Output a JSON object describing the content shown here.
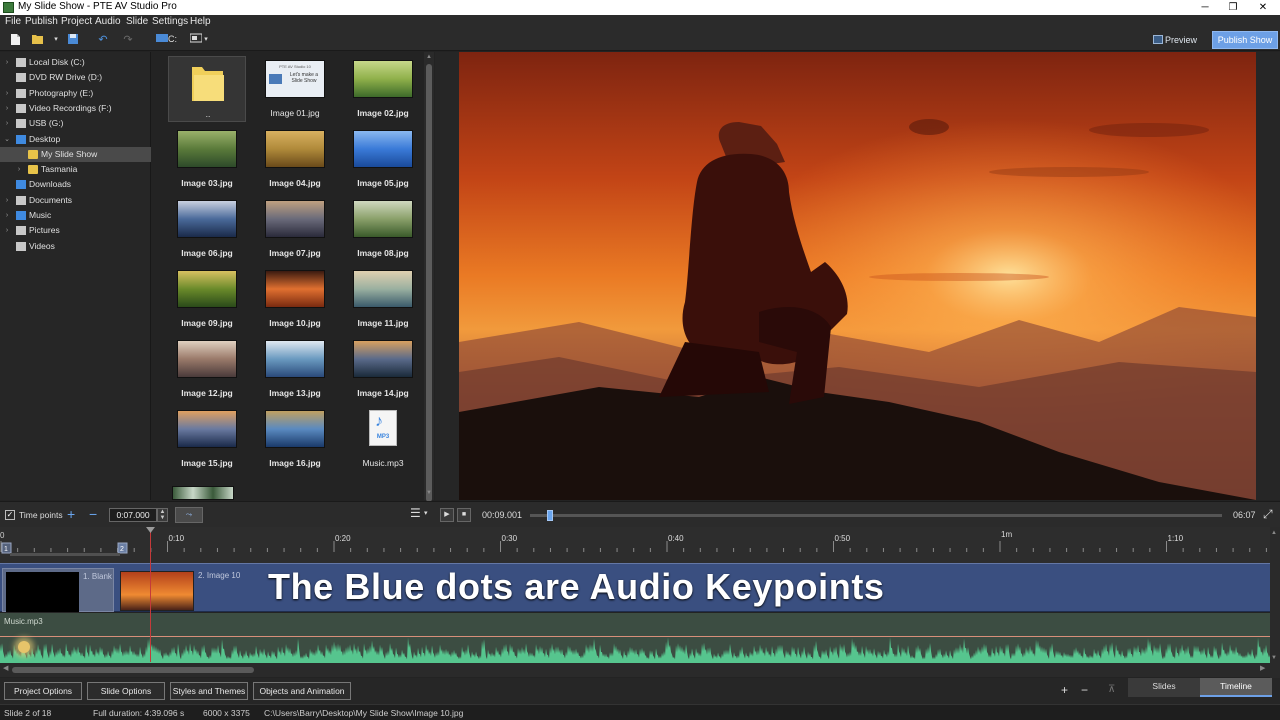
{
  "window": {
    "title": "My Slide Show - PTE AV Studio Pro",
    "minimize": "─",
    "maximize": "❐",
    "close": "✕"
  },
  "menu": [
    "File",
    "Publish",
    "Project",
    "Audio",
    "Slide",
    "Settings",
    "Help"
  ],
  "toolbar": {
    "drive_label": "C:",
    "preview_label": "Preview",
    "publish_label": "Publish Show"
  },
  "tree": [
    {
      "label": "Local Disk (C:)",
      "icon": "drive-icon",
      "expander": "›"
    },
    {
      "label": "DVD RW Drive (D:)",
      "icon": "dvd-drive-icon",
      "expander": ""
    },
    {
      "label": "Photography (E:)",
      "icon": "drive-icon",
      "expander": "›"
    },
    {
      "label": "Video Recordings (F:)",
      "icon": "drive-icon",
      "expander": "›"
    },
    {
      "label": "USB (G:)",
      "icon": "usb-drive-icon",
      "expander": "›"
    },
    {
      "label": "Desktop",
      "icon": "desktop-icon",
      "expander": "⌄"
    },
    {
      "label": "My Slide Show",
      "icon": "folder-icon",
      "expander": ""
    },
    {
      "label": "Tasmania",
      "icon": "folder-icon",
      "expander": "›"
    },
    {
      "label": "Downloads",
      "icon": "download-icon",
      "expander": ""
    },
    {
      "label": "Documents",
      "icon": "documents-icon",
      "expander": "›"
    },
    {
      "label": "Music",
      "icon": "music-icon",
      "expander": "›"
    },
    {
      "label": "Pictures",
      "icon": "pictures-icon",
      "expander": "›"
    },
    {
      "label": "Videos",
      "icon": "videos-icon",
      "expander": ""
    }
  ],
  "files": [
    {
      "name": "..",
      "kind": "folder"
    },
    {
      "name": "Image 01.jpg",
      "kind": "title"
    },
    {
      "name": "Image 02.jpg",
      "kind": "image"
    },
    {
      "name": "Image 03.jpg",
      "kind": "image"
    },
    {
      "name": "Image 04.jpg",
      "kind": "image"
    },
    {
      "name": "Image 05.jpg",
      "kind": "image"
    },
    {
      "name": "Image 06.jpg",
      "kind": "image"
    },
    {
      "name": "Image 07.jpg",
      "kind": "image"
    },
    {
      "name": "Image 08.jpg",
      "kind": "image"
    },
    {
      "name": "Image 09.jpg",
      "kind": "image"
    },
    {
      "name": "Image 10.jpg",
      "kind": "image"
    },
    {
      "name": "Image 11.jpg",
      "kind": "image"
    },
    {
      "name": "Image 12.jpg",
      "kind": "image"
    },
    {
      "name": "Image 13.jpg",
      "kind": "image"
    },
    {
      "name": "Image 14.jpg",
      "kind": "image"
    },
    {
      "name": "Image 15.jpg",
      "kind": "image"
    },
    {
      "name": "Image 16.jpg",
      "kind": "image"
    },
    {
      "name": "Music.mp3",
      "kind": "audio"
    }
  ],
  "title_thumb": {
    "line1": "PTE AV Studio 10",
    "line2": "Let's make a",
    "line3": "Slide Show"
  },
  "audio_badge": "MP3",
  "timepoints": {
    "label": "Time points",
    "value": "0:07.000"
  },
  "playback": {
    "current": "00:09.001",
    "end": "06:07",
    "progress": 0.005
  },
  "ruler": {
    "start_label": "0",
    "marks": [
      "0:10",
      "0:20",
      "0:30",
      "0:40",
      "0:50",
      "1m",
      "1:10"
    ],
    "slide_markers": [
      "1",
      "2"
    ]
  },
  "slides": [
    {
      "number": "1.",
      "name": "Blank"
    },
    {
      "number": "2.",
      "name": "Image 10"
    }
  ],
  "overlay_text": "The Blue dots are Audio Keypoints",
  "audio_track_label": "Music.mp3",
  "bottom_buttons": [
    "Project Options",
    "Slide Options",
    "Styles and Themes",
    "Objects and Animation"
  ],
  "zoom": {
    "plus": "+",
    "minus": "−",
    "fit": "⊼"
  },
  "view_tabs": [
    "Slides",
    "Timeline"
  ],
  "status": {
    "slide": "Slide 2 of 18",
    "duration": "Full duration: 4:39.096 s",
    "size": "6000 x 3375",
    "path": "C:\\Users\\Barry\\Desktop\\My Slide Show\\Image 10.jpg"
  },
  "colors": {
    "accent": "#6da0e6",
    "slide_track": "#3a4f80",
    "waveform": "#56c58e"
  }
}
